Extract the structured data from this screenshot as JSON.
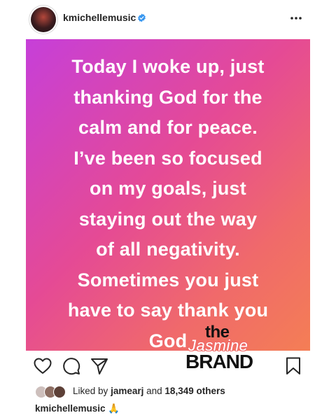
{
  "header": {
    "username": "kmichellemusic"
  },
  "post": {
    "text": "Today I woke up, just\nthanking God for the\ncalm and for peace.\nI’ve been so focused\non my goals, just\nstaying out the way\nof all negativity.\nSometimes you just\nhave to say thank you\nGod"
  },
  "watermark": {
    "the": "the",
    "jasmine": "Jasmine",
    "brand": "BRAND"
  },
  "likes": {
    "prefix": "Liked by",
    "user": "jamearj",
    "middle": "and",
    "count": "18,349 others"
  },
  "caption": {
    "username": "kmichellemusic",
    "emoji": "🙏"
  },
  "colors": {
    "gradient_start": "#c63fd9",
    "gradient_end": "#f47e55",
    "verified": "#3897f0"
  }
}
